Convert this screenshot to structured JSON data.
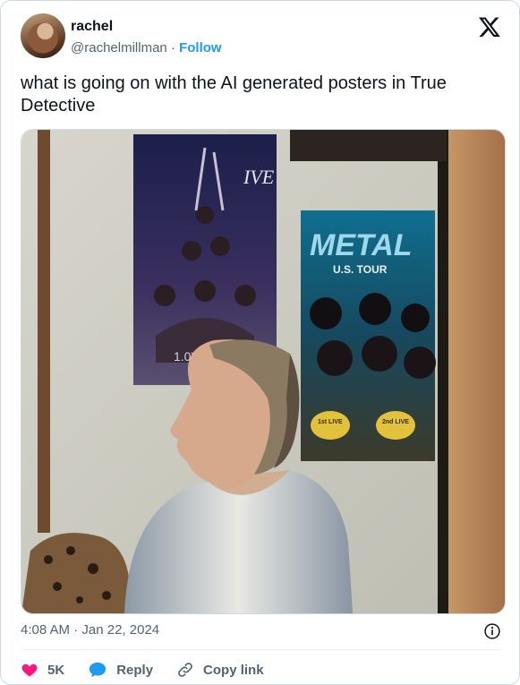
{
  "user": {
    "name": "rachel",
    "handle": "@rachelmillman",
    "separator": "·",
    "follow_label": "Follow"
  },
  "tweet": {
    "text": "what is going on with the AI generated posters in True Detective"
  },
  "media": {
    "poster_left": {
      "logo": "IVE",
      "footer": "1.0V"
    },
    "poster_right": {
      "title": "METAL",
      "subtitle": "U.S. TOUR",
      "badge1": "1st LIVE",
      "badge2": "2nd LIVE"
    }
  },
  "meta": {
    "time": "4:08 AM",
    "separator": "·",
    "date": "Jan 22, 2024"
  },
  "actions": {
    "likes": "5K",
    "reply_label": "Reply",
    "copy_link_label": "Copy link"
  },
  "colors": {
    "like": "#f91880",
    "reply": "#1d9bf0",
    "follow": "#1d9bf0",
    "text": "#0f1419",
    "muted": "#536471"
  }
}
